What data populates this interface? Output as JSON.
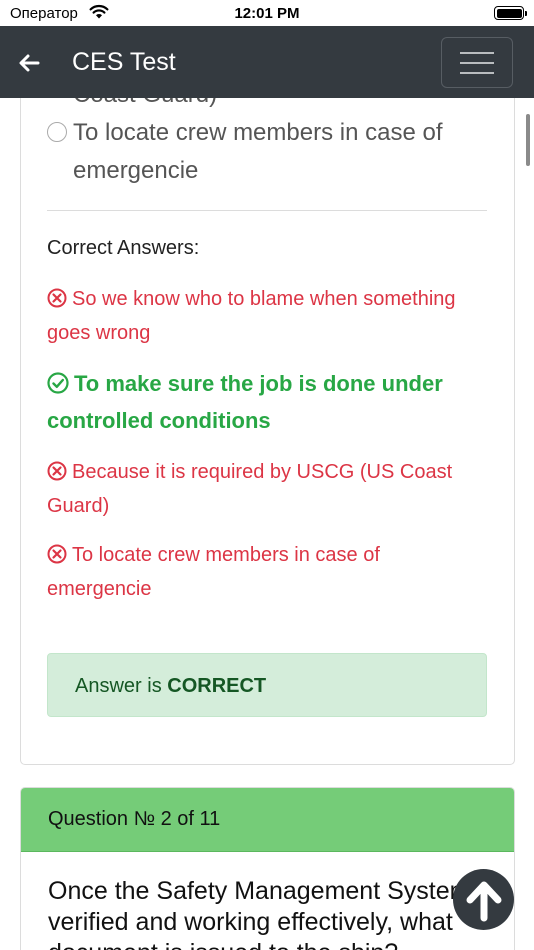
{
  "status_bar": {
    "carrier": "Оператор",
    "time": "12:01 PM"
  },
  "navbar": {
    "back_icon": "arrow-left-icon",
    "title": "CES Test",
    "menu_icon": "hamburger-menu-icon"
  },
  "question1": {
    "clipped_option": "Coast Guard)",
    "last_option": "To locate crew members in case of emergencie",
    "correct_answers_label": "Correct Answers:",
    "answers": [
      {
        "text": "So we know who to blame when something goes wrong",
        "status": "incorrect",
        "icon": "x-circle-icon"
      },
      {
        "text": "To make sure the job is done under controlled conditions",
        "status": "correct",
        "icon": "check-circle-icon"
      },
      {
        "text": "Because it is required by USCG (US Coast Guard)",
        "status": "incorrect",
        "icon": "x-circle-icon"
      },
      {
        "text": "To locate crew members in case of emergencie",
        "status": "incorrect",
        "icon": "x-circle-icon"
      }
    ],
    "result_prefix": "Answer is",
    "result_value": "CORRECT"
  },
  "question2": {
    "header": "Question № 2 of 11",
    "text": "Once the Safety Management System is verified and working effectively, what document is issued to the ship?"
  },
  "scroll_top_icon": "arrow-up-icon",
  "colors": {
    "navbar": "#343a40",
    "incorrect": "#dc3545",
    "correct": "#28a745",
    "alert_bg": "#d4edda",
    "alert_text": "#155724",
    "question_header": "#75cc78"
  }
}
